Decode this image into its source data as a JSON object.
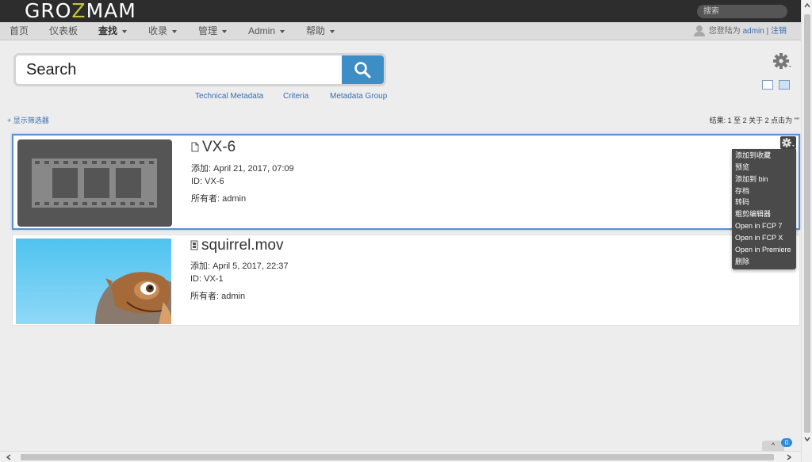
{
  "app": {
    "logo_pre": "GRO",
    "logo_z": "Z",
    "logo_post": "MAM",
    "top_search_placeholder": "搜索"
  },
  "nav": {
    "items": [
      {
        "label": "首页",
        "caret": false,
        "bold": false
      },
      {
        "label": "仪表板",
        "caret": false,
        "bold": false
      },
      {
        "label": "查找",
        "caret": true,
        "bold": true
      },
      {
        "label": "收录",
        "caret": true,
        "bold": false
      },
      {
        "label": "管理",
        "caret": true,
        "bold": false
      },
      {
        "label": "Admin",
        "caret": true,
        "bold": false
      },
      {
        "label": "帮助",
        "caret": true,
        "bold": false
      }
    ],
    "login_prefix": "您登陆为 ",
    "username": "admin",
    "separator": " | ",
    "logout": "注销"
  },
  "search": {
    "placeholder": "Search",
    "links": [
      "Technical Metadata",
      "Criteria",
      "Metadata Group"
    ],
    "show_filters": "+ 显示筛选器",
    "results_text": "结果: 1 至 2 关于 2 点击为 \"\""
  },
  "results": [
    {
      "title": "VX-6",
      "added": "添加: April 21, 2017, 07:09",
      "id": "ID: VX-6",
      "owner": "所有者: admin",
      "icon": "document-icon",
      "thumbnail": "film-placeholder"
    },
    {
      "title": "squirrel.mov",
      "added": "添加: April 5, 2017, 22:37",
      "id": "ID: VX-1",
      "owner": "所有者: admin",
      "icon": "film-icon",
      "thumbnail": "squirrel-frame"
    }
  ],
  "context_menu": [
    "添加到收藏",
    "预览",
    "添加到 bin",
    "存档",
    "转码",
    "粗剪编辑器",
    "Open in FCP 7",
    "Open in FCP X",
    "Open in Premiere",
    "删除"
  ],
  "scroll_top": {
    "label": "^",
    "badge": "0"
  },
  "colors": {
    "accent": "#3d8ec7",
    "topbar": "#2d2d2d",
    "link": "#3a6eb0",
    "selected_border": "#5b8fd1"
  }
}
